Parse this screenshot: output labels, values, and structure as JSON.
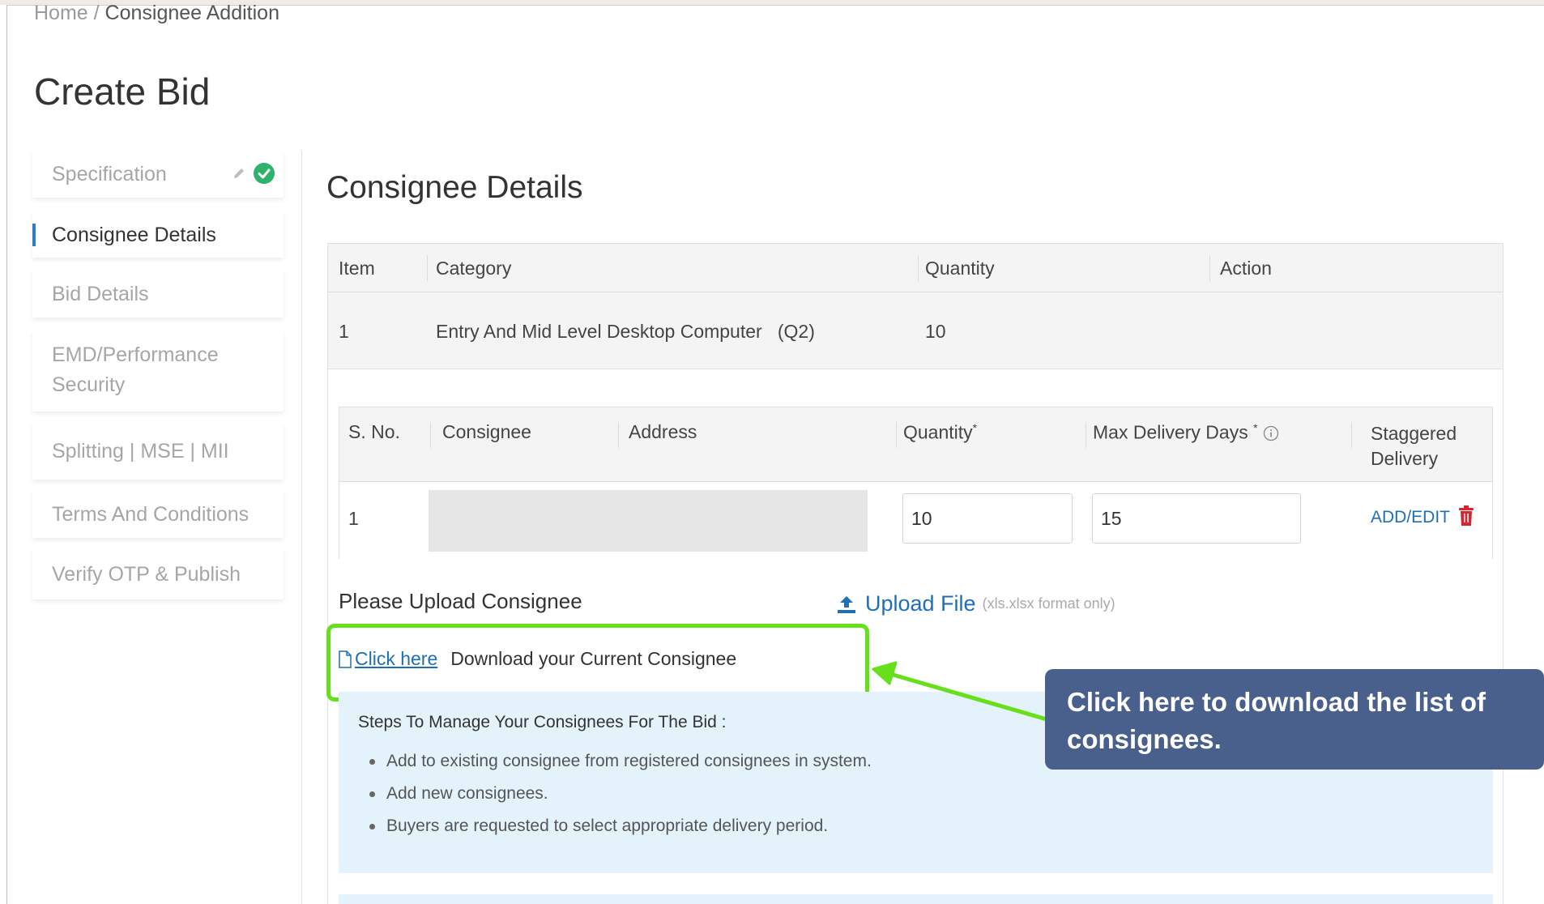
{
  "breadcrumb": {
    "home": "Home",
    "separator": " / ",
    "current": "Consignee Addition"
  },
  "page_title": "Create Bid",
  "sidebar": {
    "items": [
      {
        "label": "Specification",
        "state": "completed"
      },
      {
        "label": "Consignee Details",
        "state": "active"
      },
      {
        "label": "Bid Details",
        "state": "pending"
      },
      {
        "label": "EMD/Performance Security",
        "line1": "EMD/Performance",
        "line2": "Security",
        "state": "pending"
      },
      {
        "label": "Splitting | MSE | MII",
        "state": "pending"
      },
      {
        "label": "Terms And Conditions",
        "state": "pending"
      },
      {
        "label": "Verify OTP & Publish",
        "state": "pending"
      }
    ]
  },
  "section_title": "Consignee Details",
  "item_table": {
    "headers": [
      "Item",
      "Category",
      "Quantity",
      "Action"
    ],
    "rows": [
      {
        "item": "1",
        "category": "Entry And Mid Level Desktop Computer",
        "category_suffix": "(Q2)",
        "quantity": "10",
        "action": ""
      }
    ]
  },
  "consignee_table": {
    "headers": {
      "sno": "S. No.",
      "consignee": "Consignee",
      "address": "Address",
      "quantity": "Quantity",
      "quantity_req": "*",
      "max_days": "Max Delivery Days",
      "max_days_req": "*",
      "staggered_line1": "Staggered",
      "staggered_line2": "Delivery"
    },
    "rows": [
      {
        "sno": "1",
        "quantity": "10",
        "max_days": "15",
        "action": "ADD/EDIT"
      }
    ]
  },
  "upload": {
    "label": "Please Upload Consignee",
    "button": "Upload File",
    "format_note": "(xls.xlsx format only)"
  },
  "download": {
    "link": "Click here",
    "text": "Download your Current Consignee"
  },
  "steps": {
    "title": "Steps To Manage Your Consignees For The Bid :",
    "items": [
      "Add to existing consignee from registered consignees in system.",
      "Add new consignees.",
      "Buyers are requested to select appropriate delivery period."
    ]
  },
  "callout": {
    "line1": "Click here to download the list of",
    "line2": "consignees."
  },
  "colors": {
    "accent_blue": "#1e6fb8",
    "highlight_green": "#66e01a",
    "callout_bg": "#495f8c",
    "success_green": "#2db36b",
    "danger_red": "#d9232e",
    "steps_bg": "#e3f2fb"
  },
  "icons": {
    "spec_edit": "pencil-icon",
    "spec_done": "check-circle-icon",
    "info": "info-icon",
    "delete": "trash-icon",
    "upload": "upload-icon",
    "file": "file-icon"
  }
}
